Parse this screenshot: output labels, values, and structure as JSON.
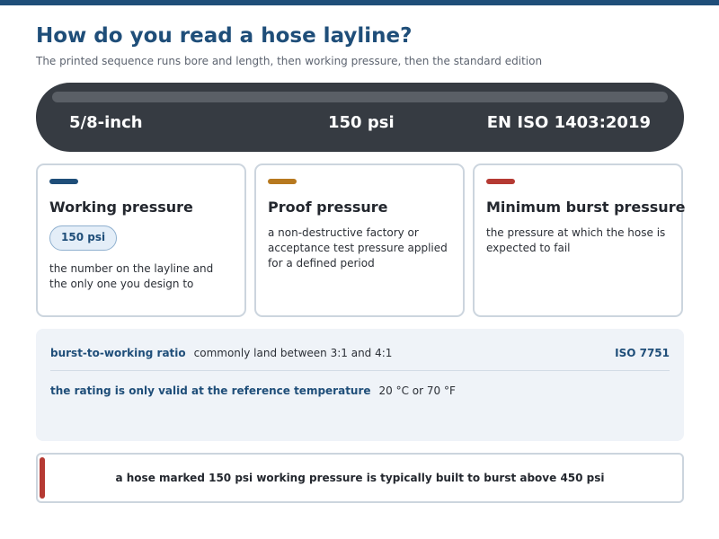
{
  "header": {
    "title": "How do you read a hose layline?",
    "subtitle": "The printed sequence runs bore and length, then working pressure, then the standard edition"
  },
  "layline": {
    "segments": [
      "5/8-inch",
      "150 psi",
      "EN ISO 1403:2019"
    ]
  },
  "cards": [
    {
      "title": "Working pressure",
      "badge": "150 psi",
      "description": "the number on the layline and the only one you design to",
      "accent_color": "#1f4e79"
    },
    {
      "title": "Proof pressure",
      "description": "a non-destructive factory or acceptance test pressure applied for a defined period",
      "accent_color": "#b7791f"
    },
    {
      "title": "Minimum burst pressure",
      "description": "the pressure at which the hose is expected to fail",
      "accent_color": "#b53a33"
    }
  ],
  "info": {
    "rows": [
      {
        "key": "burst-to-working ratio",
        "value": "commonly land between 3:1 and 4:1",
        "ref": "ISO 7751"
      },
      {
        "key": "the rating is only valid at the reference temperature",
        "value": "20 °C or 70 °F"
      }
    ]
  },
  "note": {
    "text": "a hose marked 150 psi working pressure is typically built to burst above 450 psi",
    "accent_color": "#b53a33"
  }
}
